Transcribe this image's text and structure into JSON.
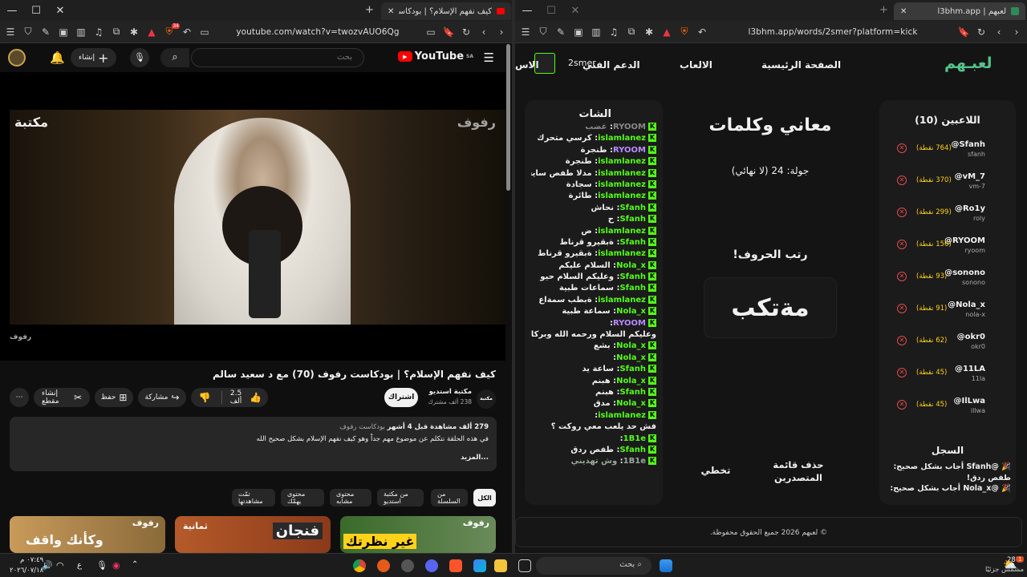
{
  "left_window": {
    "tab_title": "كيف نفهم الإسلام؟ | بودكاست ر",
    "url": "youtube.com/watch?v=twozvAUO6Qg",
    "badge": "34",
    "youtube": {
      "logo": "YouTube",
      "region": "SA",
      "search_placeholder": "بحث",
      "create_label": "إنشاء",
      "video_overlay_brand": "رفوف",
      "video_overlay_channel": "مكتبة",
      "video_overlay_sub": "رفوف",
      "title": "كيف نفهم الإسلام؟ | بودكاست رفوف (70) مع د سعيد سالم",
      "channel_name": "مكتبة استديو",
      "subscribers": "238 ألف مشترك",
      "subscribe_label": "اشتراك",
      "likes": "2.5 ألف",
      "share_label": "مشاركة",
      "save_label": "حفظ",
      "clip_label": "إنشاء مقطع",
      "desc_stats": "279 ألف مشاهدة  قبل 4 أشهر",
      "desc_tags": "بودكاست رفوف",
      "desc_text": "في هذه الحلقة نتكلم عن موضوع مهم جداً وهو كيف نفهم الإسلام بشكل صحيح الله",
      "desc_more": "...المزيد",
      "chips": [
        "الكل",
        "من السلسلة",
        "من مكتبة استديو",
        "محتوى مشابه",
        "محتوى يهمّك",
        "تمّت مشاهدتها"
      ],
      "thumbs": [
        "وكأنك واقف",
        "ثمانية",
        "فنجان",
        "غير نظرتك",
        "رفوف",
        "رفوف"
      ]
    }
  },
  "right_window": {
    "tab_title": "لعبهم | l3bhm.app",
    "url": "l3bhm.app/words/2smer?platform=kick",
    "nav": {
      "logo": "لعبـهم",
      "home": "الصفحة الرئيسية",
      "games": "الالعاب",
      "support": "الدعم الفني",
      "extra": "الاس",
      "user": "2smer"
    },
    "players_title": "اللاعبين (10)",
    "players": [
      {
        "name": "@Sfanh",
        "user": "sfanh",
        "score": "(764 نقطة)"
      },
      {
        "name": "@vM_7",
        "user": "vm-7",
        "score": "(370 نقطة)"
      },
      {
        "name": "@Ro1y",
        "user": "roly",
        "score": "(299 نقطة)"
      },
      {
        "name": "@RYOOM",
        "user": "ryoom",
        "score": "(156 نقطة)"
      },
      {
        "name": "@sonono",
        "user": "sonono",
        "score": "(93 نقطة)"
      },
      {
        "name": "@Nola_x",
        "user": "nola-x",
        "score": "(91 نقطة)"
      },
      {
        "name": "@okr0",
        "user": "okr0",
        "score": "(62 نقطة)"
      },
      {
        "name": "@11LA",
        "user": "11la",
        "score": "(45 نقطة)"
      },
      {
        "name": "@IlLwa",
        "user": "illwa",
        "score": "(45 نقطة)"
      }
    ],
    "log_title": "السجل",
    "log": [
      "🎉 @Sfanh أجاب بشكل صحيح:",
      "طفص ردق!",
      "🎉 @Nola_x أجاب بشكل صحيح:"
    ],
    "game": {
      "title": "معاني وكلمات",
      "round": "جولة: 24 (لا نهائي)",
      "prompt": "رتب الحروف!",
      "scrambled": "مةتكب",
      "reset_btn": "حذف قائمة المتصدرين",
      "skip_btn": "تخطي"
    },
    "chat_title": "الشات",
    "chat": [
      {
        "user": "RYOOM",
        "msg": "غضب",
        "color": "#888888"
      },
      {
        "user": "islamlanez",
        "msg": "كرسي متحرك",
        "color": "#53fc18"
      },
      {
        "user": "RYOOM",
        "msg": "طنجرة",
        "color": "#b68cff"
      },
      {
        "user": "islamlanez",
        "msg": "طنجرة",
        "color": "#53fc18"
      },
      {
        "user": "islamlanez",
        "msg": "مدلا طفص سايقم",
        "color": "#53fc18"
      },
      {
        "user": "islamlanez",
        "msg": "سجادة",
        "color": "#53fc18"
      },
      {
        "user": "islamlanez",
        "msg": "طائرة",
        "color": "#53fc18"
      },
      {
        "user": "Sfanh",
        "msg": "نحاش",
        "color": "#53fc18"
      },
      {
        "user": "Sfanh",
        "msg": "ح",
        "color": "#53fc18"
      },
      {
        "user": "islamlanez",
        "msg": "ض",
        "color": "#53fc18"
      },
      {
        "user": "Sfanh",
        "msg": "ةبقيرو قرناط",
        "color": "#53fc18"
      },
      {
        "user": "islamlanez",
        "msg": "ةبقيرو قرناط",
        "color": "#53fc18"
      },
      {
        "user": "Nola_x",
        "msg": "السلام عليكم",
        "color": "#53fc18"
      },
      {
        "user": "Sfanh",
        "msg": "وعليكم السلام حيو",
        "color": "#53fc18"
      },
      {
        "user": "Sfanh",
        "msg": "سماعات طبية",
        "color": "#53fc18"
      },
      {
        "user": "islamlanez",
        "msg": "ةبطب سمةاع",
        "color": "#53fc18"
      },
      {
        "user": "Nola_x",
        "msg": "سماعة طبية",
        "color": "#53fc18"
      },
      {
        "user": "RYOOM",
        "msg": "",
        "color": "#b68cff"
      },
      {
        "user": "",
        "msg": "وعليكم السلام ورحمه الله وبركاته",
        "color": "#53fc18"
      },
      {
        "user": "Nola_x",
        "msg": "بشع",
        "color": "#53fc18"
      },
      {
        "user": "Nola_x",
        "msg": "",
        "color": "#53fc18"
      },
      {
        "user": "Sfanh",
        "msg": "ساعة يد",
        "color": "#53fc18"
      },
      {
        "user": "Nola_x",
        "msg": "هبنم",
        "color": "#53fc18"
      },
      {
        "user": "Sfanh",
        "msg": "هبنم",
        "color": "#53fc18"
      },
      {
        "user": "Nola_x",
        "msg": "مدق",
        "color": "#53fc18"
      },
      {
        "user": "islamlanez",
        "msg": "",
        "color": "#53fc18"
      },
      {
        "user": "",
        "msg": "فش حد يلعب معي روكت ؟",
        "color": "#53fc18"
      },
      {
        "user": "1B1e",
        "msg": "",
        "color": "#53fc18"
      },
      {
        "user": "Sfanh",
        "msg": "طفص ردق",
        "color": "#53fc18"
      },
      {
        "user": "1B1e",
        "msg": "وش تهديني",
        "color": "#9aa89a"
      }
    ],
    "footer": "© لعبهم 2026 جميع الحقوق محفوظة."
  },
  "taskbar": {
    "weather_temp": "28°C",
    "weather_desc": "مشمس جزئيًا",
    "search_placeholder": "بحث",
    "time": "٠٧:٤٩ م",
    "date": "٢٠٢٦/٠٧/١٨",
    "lang": "ع",
    "notif": "1"
  },
  "colors": {
    "kick_green": "#53fc18",
    "yt_red": "#ff0000",
    "score_gold": "#ffd21a"
  }
}
